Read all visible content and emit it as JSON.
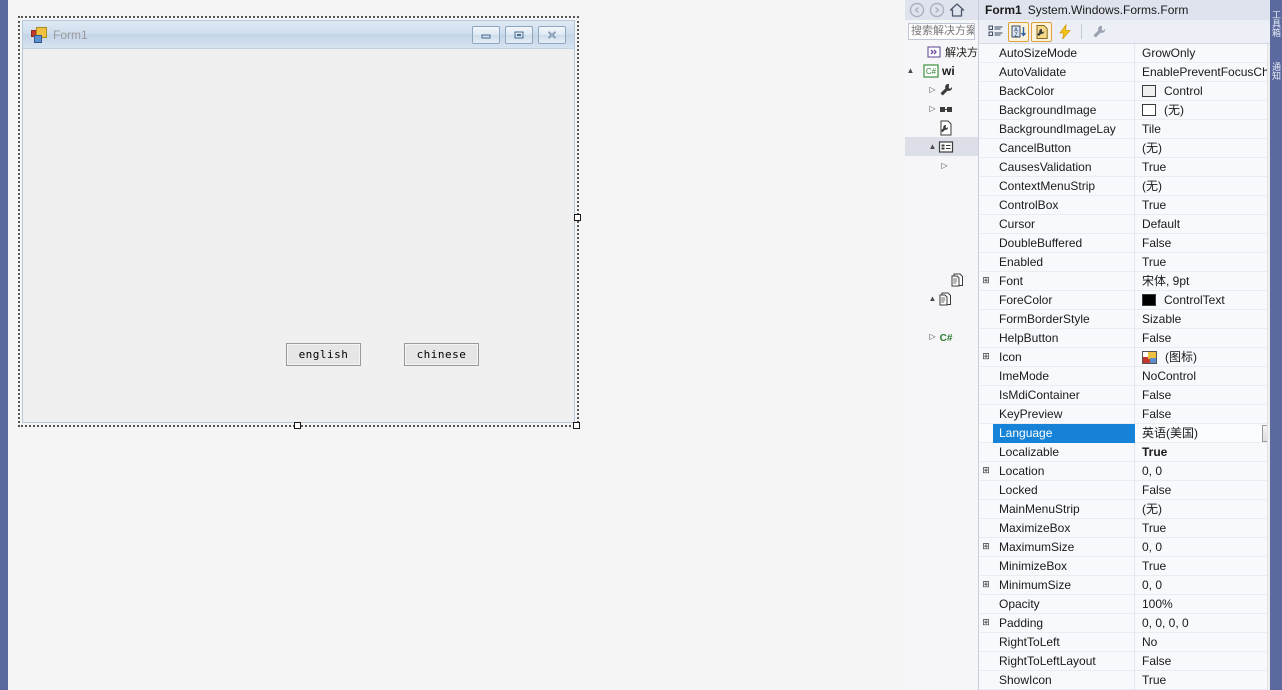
{
  "designer": {
    "form": {
      "title": "Form1",
      "icon": "form-icon",
      "window_buttons": [
        {
          "name": "minimize-button",
          "glyph": "minimize-icon"
        },
        {
          "name": "maximize-button",
          "glyph": "maximize-icon"
        },
        {
          "name": "close-button",
          "glyph": "close-icon"
        }
      ],
      "buttons": [
        {
          "name": "english-button",
          "text": "english"
        },
        {
          "name": "chinese-button",
          "text": "chinese"
        }
      ]
    },
    "selection_handles": [
      "right-middle",
      "bottom-middle",
      "bottom-right"
    ]
  },
  "solution_explorer": {
    "nav": [
      {
        "name": "back-icon",
        "enabled": false
      },
      {
        "name": "forward-icon",
        "enabled": false
      },
      {
        "name": "home-icon",
        "enabled": true
      }
    ],
    "search": {
      "value": "",
      "placeholder": "搜索解决方案资源管理器"
    },
    "tree": [
      {
        "indent": 0,
        "expander": "",
        "icon": "solution-icon",
        "label": "解决方案"
      },
      {
        "indent": 0,
        "expander": "▲",
        "icon": "csharp-project-icon",
        "label": "wi"
      },
      {
        "indent": 1,
        "expander": "▷",
        "icon": "properties-wrench-icon",
        "label": ""
      },
      {
        "indent": 1,
        "expander": "▷",
        "icon": "references-icon",
        "label": ""
      },
      {
        "indent": 1,
        "expander": "",
        "icon": "config-file-icon",
        "label": ""
      },
      {
        "indent": 1,
        "expander": "▲",
        "icon": "form-designer-icon",
        "label": "",
        "selected": true
      },
      {
        "indent": 2,
        "expander": "▷",
        "icon": "",
        "label": ""
      },
      {
        "indent": 2,
        "expander": "",
        "icon": "",
        "label": ""
      },
      {
        "indent": 2,
        "expander": "",
        "icon": "",
        "label": ""
      },
      {
        "indent": 2,
        "expander": "",
        "icon": "",
        "label": ""
      },
      {
        "indent": 2,
        "expander": "",
        "icon": "resx-file-icon",
        "label": ""
      },
      {
        "indent": 2,
        "expander": "▲",
        "icon": "resx-file-icon",
        "label": ""
      },
      {
        "indent": 2,
        "expander": "",
        "icon": "",
        "label": ""
      },
      {
        "indent": 2,
        "expander": "▷",
        "icon": "csharp-file-icon",
        "label": ""
      }
    ]
  },
  "properties": {
    "header": {
      "object_name": "Form1",
      "object_type": "System.Windows.Forms.Form",
      "dropdown_glyph": "▾"
    },
    "toolbar": [
      {
        "name": "categorized-button",
        "glyph": "categorized-icon",
        "active": false
      },
      {
        "name": "alphabetical-button",
        "glyph": "sort-az-icon",
        "active": true
      },
      {
        "name": "properties-button",
        "glyph": "properties-page-icon",
        "active": true
      },
      {
        "name": "events-button",
        "glyph": "lightning-icon",
        "active": false
      },
      {
        "name": "separator",
        "glyph": "separator",
        "active": false
      },
      {
        "name": "property-pages-button",
        "glyph": "wrench-icon",
        "active": false
      }
    ],
    "rows": [
      {
        "expander": "",
        "name": "AutoSizeMode",
        "value": "GrowOnly"
      },
      {
        "expander": "",
        "name": "AutoValidate",
        "value": "EnablePreventFocusCh"
      },
      {
        "expander": "",
        "name": "BackColor",
        "value": "Control",
        "swatch": "#f0f0f0"
      },
      {
        "expander": "",
        "name": "BackgroundImage",
        "value": "(无)",
        "swatch": "#ffffff"
      },
      {
        "expander": "",
        "name": "BackgroundImageLay",
        "value": "Tile"
      },
      {
        "expander": "",
        "name": "CancelButton",
        "value": "(无)"
      },
      {
        "expander": "",
        "name": "CausesValidation",
        "value": "True"
      },
      {
        "expander": "",
        "name": "ContextMenuStrip",
        "value": "(无)"
      },
      {
        "expander": "",
        "name": "ControlBox",
        "value": "True"
      },
      {
        "expander": "",
        "name": "Cursor",
        "value": "Default"
      },
      {
        "expander": "",
        "name": "DoubleBuffered",
        "value": "False"
      },
      {
        "expander": "",
        "name": "Enabled",
        "value": "True"
      },
      {
        "expander": "⊞",
        "name": "Font",
        "value": "宋体, 9pt"
      },
      {
        "expander": "",
        "name": "ForeColor",
        "value": "ControlText",
        "swatch": "#000000"
      },
      {
        "expander": "",
        "name": "FormBorderStyle",
        "value": "Sizable"
      },
      {
        "expander": "",
        "name": "HelpButton",
        "value": "False"
      },
      {
        "expander": "⊞",
        "name": "Icon",
        "value": "(图标)",
        "iconswatch": true
      },
      {
        "expander": "",
        "name": "ImeMode",
        "value": "NoControl"
      },
      {
        "expander": "",
        "name": "IsMdiContainer",
        "value": "False"
      },
      {
        "expander": "",
        "name": "KeyPreview",
        "value": "False"
      },
      {
        "expander": "",
        "name": "Language",
        "value": "英语(美国)",
        "selected": true,
        "dropdown": true
      },
      {
        "expander": "",
        "name": "Localizable",
        "value": "True",
        "bold": true
      },
      {
        "expander": "⊞",
        "name": "Location",
        "value": "0, 0"
      },
      {
        "expander": "",
        "name": "Locked",
        "value": "False"
      },
      {
        "expander": "",
        "name": "MainMenuStrip",
        "value": "(无)"
      },
      {
        "expander": "",
        "name": "MaximizeBox",
        "value": "True"
      },
      {
        "expander": "⊞",
        "name": "MaximumSize",
        "value": "0, 0"
      },
      {
        "expander": "",
        "name": "MinimizeBox",
        "value": "True"
      },
      {
        "expander": "⊞",
        "name": "MinimumSize",
        "value": "0, 0"
      },
      {
        "expander": "",
        "name": "Opacity",
        "value": "100%"
      },
      {
        "expander": "⊞",
        "name": "Padding",
        "value": "0, 0, 0, 0"
      },
      {
        "expander": "",
        "name": "RightToLeft",
        "value": "No"
      },
      {
        "expander": "",
        "name": "RightToLeftLayout",
        "value": "False"
      },
      {
        "expander": "",
        "name": "ShowIcon",
        "value": "True"
      }
    ],
    "scrollbar": {
      "up_glyph": "▲"
    }
  },
  "right_tabs": [
    {
      "name": "toolbox-tab",
      "label": "工具箱"
    },
    {
      "name": "data-sources-tab",
      "label": "通知"
    }
  ],
  "colors": {
    "accent": "#1683d8",
    "dock_blue": "#5a6a9e",
    "header_bg": "#dfe3ee",
    "toolbar_active": "#e0a33b"
  }
}
